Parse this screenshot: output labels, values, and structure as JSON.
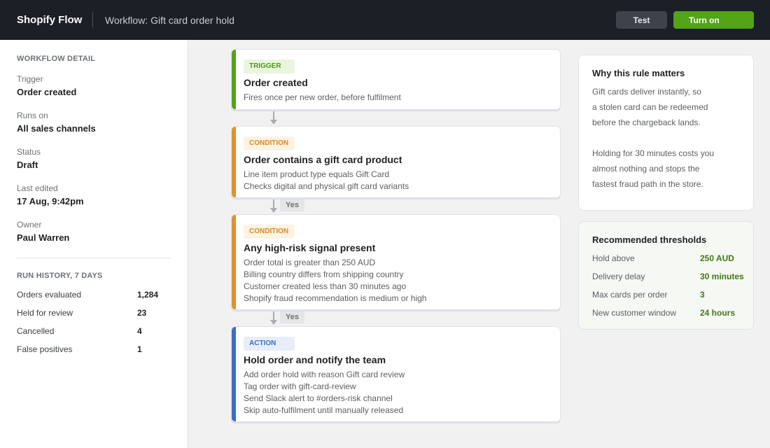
{
  "topbar": {
    "brand": "Shopify Flow",
    "breadcrumb": "Workflow: Gift card order hold",
    "test_label": "Test",
    "turn_on_label": "Turn on"
  },
  "sidebar": {
    "detail_title": "WORKFLOW DETAIL",
    "details": [
      {
        "label": "Trigger",
        "value": "Order created"
      },
      {
        "label": "Runs on",
        "value": "All sales channels"
      },
      {
        "label": "Status",
        "value": "Draft"
      },
      {
        "label": "Last edited",
        "value": "17 Aug, 9:42pm"
      },
      {
        "label": "Owner",
        "value": "Paul Warren"
      }
    ],
    "history_title": "RUN HISTORY, 7 DAYS",
    "history": [
      {
        "label": "Orders evaluated",
        "value": "1,284"
      },
      {
        "label": "Held for review",
        "value": "23"
      },
      {
        "label": "Cancelled",
        "value": "4"
      },
      {
        "label": "False positives",
        "value": "1"
      }
    ]
  },
  "workflow": {
    "steps": [
      {
        "type": "TRIGGER",
        "title": "Order created",
        "lines": [
          "Fires once per new order, before fulfilment"
        ]
      },
      {
        "type": "CONDITION",
        "title": "Order contains a gift card product",
        "lines": [
          "Line item product type equals Gift Card",
          "Checks digital and physical gift card variants"
        ]
      },
      {
        "type": "CONDITION",
        "title": "Any high-risk signal present",
        "lines": [
          "Order total is greater than 250 AUD",
          "Billing country differs from shipping country",
          "Customer created less than 30 minutes ago",
          "Shopify fraud recommendation is medium or high"
        ]
      },
      {
        "type": "ACTION",
        "title": "Hold order and notify the team",
        "lines": [
          "Add order hold with reason Gift card review",
          "Tag order with gift-card-review",
          "Send Slack alert to #orders-risk channel",
          "Skip auto-fulfilment until manually released"
        ]
      }
    ],
    "connector_labels": [
      "Yes",
      "Yes"
    ]
  },
  "why_panel": {
    "title": "Why this rule matters",
    "lines": [
      "Gift cards deliver instantly, so",
      "a stolen card can be redeemed",
      "before the chargeback lands.",
      "Holding for 30 minutes costs you",
      "almost nothing and stops the",
      "fastest fraud path in the store."
    ]
  },
  "thresholds_panel": {
    "title": "Recommended thresholds",
    "rows": [
      {
        "label": "Hold above",
        "value": "250 AUD"
      },
      {
        "label": "Delivery delay",
        "value": "30 minutes"
      },
      {
        "label": "Max cards per order",
        "value": "3"
      },
      {
        "label": "New customer window",
        "value": "24 hours"
      }
    ]
  },
  "colors": {
    "trigger": "#52a318",
    "condition": "#e0922b",
    "action": "#3a6ec4",
    "topbar": "#1b1f26",
    "primary_button": "#52a318"
  }
}
